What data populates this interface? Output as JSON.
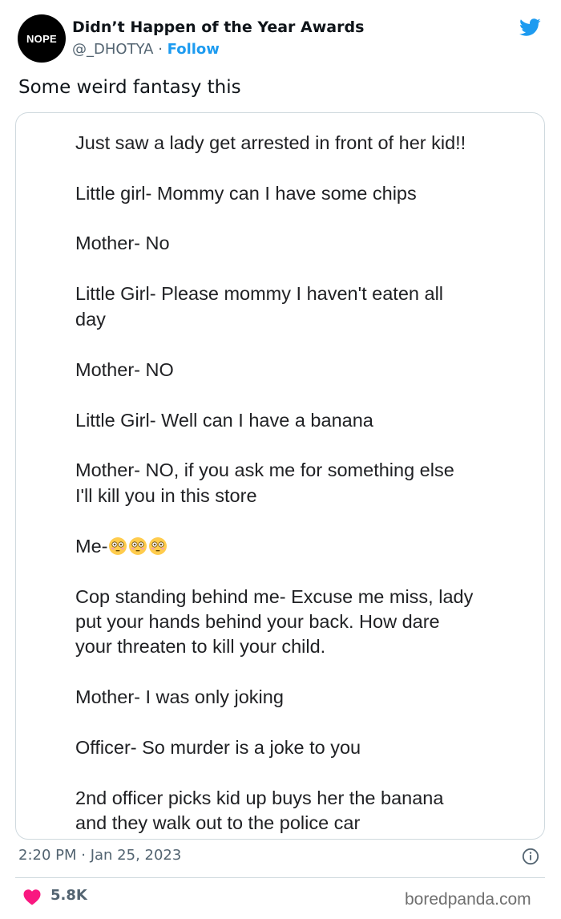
{
  "author": {
    "avatar_text": "NOPE",
    "name": "Didn’t Happen of the Year Awards",
    "handle": "@_DHOTYA",
    "separator": " · ",
    "follow_label": "Follow"
  },
  "tweet": {
    "text": "Some weird fantasy this",
    "timestamp": "2:20 PM · Jan 25, 2023",
    "like_count": "5.8K"
  },
  "note_lines": [
    "Just saw a lady get arrested in front of her kid!!",
    "Little girl- Mommy can I have some chips",
    "Mother- No",
    "Little Girl- Please mommy I haven't eaten all",
    "day",
    "Mother- NO",
    "Little Girl- Well can I have a banana",
    "Mother- NO, if you ask me for something else",
    "I'll kill you in this store",
    "Me-",
    "Cop standing behind me- Excuse me miss, lady",
    "put your hands behind your back. How dare",
    "your threaten to kill your child.",
    "Mother- I was only joking",
    "Officer- So murder is a joke to you",
    "2nd officer picks kid up buys her the banana",
    "and they walk out to the police car"
  ],
  "icons": {
    "twitter": "twitter-bird-icon",
    "info": "info-icon",
    "heart": "heart-icon",
    "emoji": "flushed-face-emoji"
  },
  "colors": {
    "accent": "#1d9bf0",
    "like": "#f91880",
    "muted_text": "#536471",
    "border": "#cfd9de"
  },
  "watermark": "boredpanda.com"
}
